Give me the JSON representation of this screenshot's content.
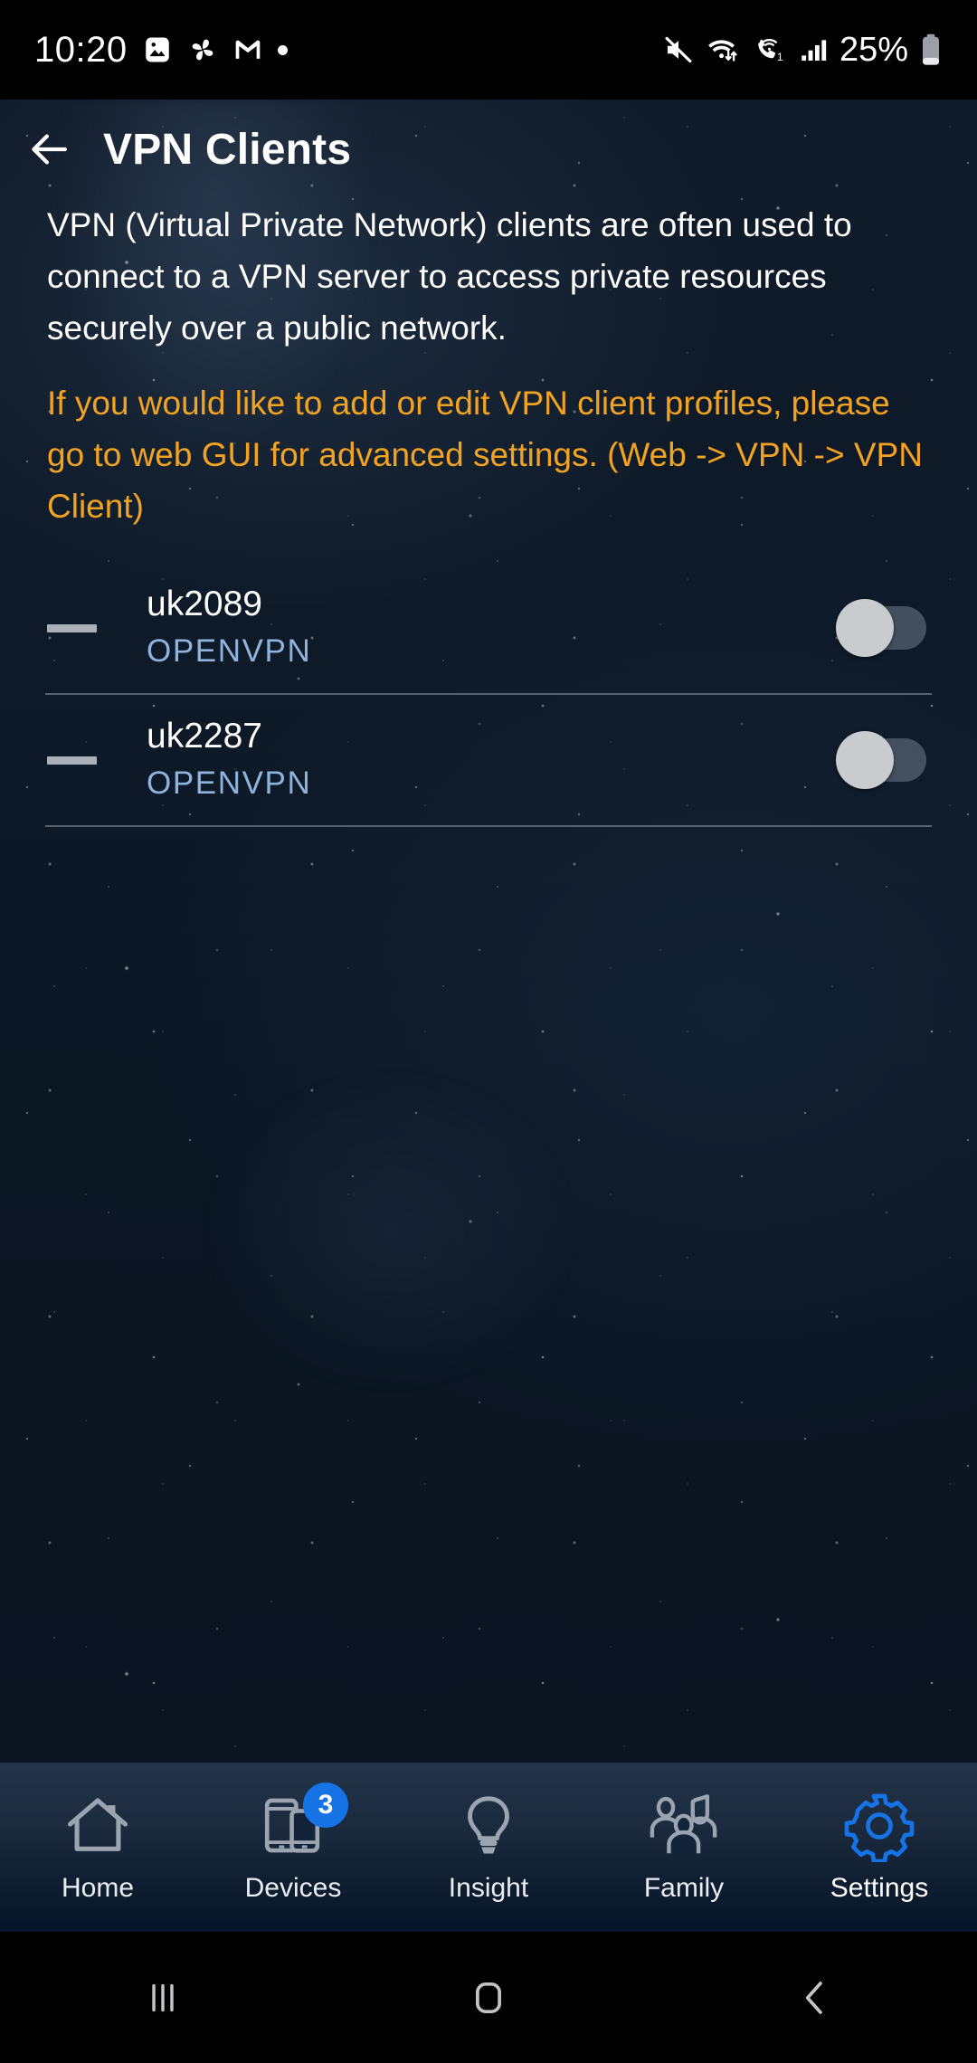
{
  "status_bar": {
    "time": "10:20",
    "battery_percent": "25%",
    "left_icons": [
      "gallery-image-icon",
      "pinwheel-icon",
      "gmail-icon",
      "notification-dot-icon"
    ],
    "right_icons": [
      "mute-icon",
      "wifi-icon",
      "wifi-calling-icon",
      "cellular-signal-icon",
      "battery-icon"
    ]
  },
  "header": {
    "back_icon": "back-arrow-icon",
    "title": "VPN Clients"
  },
  "main": {
    "description": "VPN (Virtual Private Network) clients are often used to connect to a VPN server to access private resources securely over a public network.",
    "note": "If you would like to add or edit VPN client profiles, please go to web GUI for advanced settings. (Web -> VPN -> VPN Client)",
    "note_color": "#f2a321",
    "vpn_clients": [
      {
        "name": "uk2089",
        "type": "OPENVPN",
        "enabled": false,
        "status_icon": "dash-icon"
      },
      {
        "name": "uk2287",
        "type": "OPENVPN",
        "enabled": false,
        "status_icon": "dash-icon"
      }
    ]
  },
  "bottom_nav": {
    "active_color": "#1573e6",
    "inactive_color": "#9aa5b1",
    "items": [
      {
        "label": "Home",
        "icon": "home-icon",
        "active": false,
        "badge": ""
      },
      {
        "label": "Devices",
        "icon": "devices-icon",
        "active": false,
        "badge": "3"
      },
      {
        "label": "Insight",
        "icon": "lightbulb-icon",
        "active": false,
        "badge": ""
      },
      {
        "label": "Family",
        "icon": "family-icon",
        "active": false,
        "badge": ""
      },
      {
        "label": "Settings",
        "icon": "gear-icon",
        "active": true,
        "badge": ""
      }
    ]
  },
  "system_nav": {
    "recents": "recents-icon",
    "home": "home-square-icon",
    "back": "back-chevron-icon"
  }
}
